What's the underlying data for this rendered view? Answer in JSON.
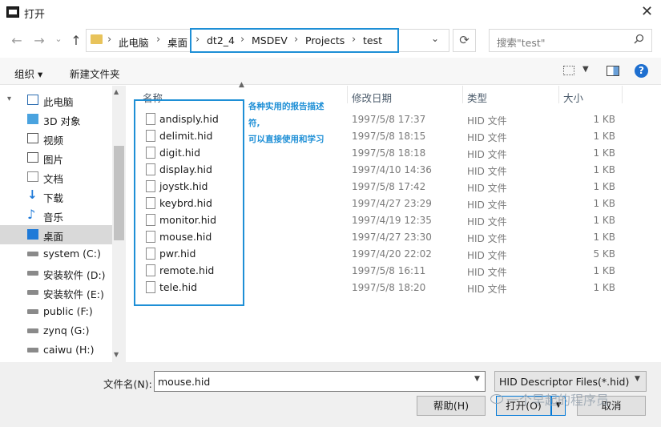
{
  "window": {
    "title": "打开",
    "close_glyph": "✕"
  },
  "nav": {
    "back_glyph": "←",
    "forward_glyph": "→",
    "dropdown_glyph": "⌄",
    "up_glyph": "↑",
    "breadcrumb": [
      "此电脑",
      "桌面",
      "dt2_4",
      "MSDEV",
      "Projects",
      "test"
    ],
    "separator": "›",
    "refresh_glyph": "⟳",
    "search_placeholder": "搜索\"test\"",
    "search_icon": "search-icon"
  },
  "toolbar": {
    "organize": "组织 ▾",
    "new_folder": "新建文件夹",
    "help_glyph": "?"
  },
  "sidebar": {
    "items": [
      {
        "label": "此电脑",
        "icon": "pc-icon"
      },
      {
        "label": "3D 对象",
        "icon": "cube-icon"
      },
      {
        "label": "视频",
        "icon": "video-icon"
      },
      {
        "label": "图片",
        "icon": "picture-icon"
      },
      {
        "label": "文档",
        "icon": "document-icon"
      },
      {
        "label": "下载",
        "icon": "download-icon"
      },
      {
        "label": "音乐",
        "icon": "music-icon"
      },
      {
        "label": "桌面",
        "icon": "desktop-icon",
        "selected": true
      },
      {
        "label": "system (C:)",
        "icon": "drive-icon"
      },
      {
        "label": "安装软件 (D:)",
        "icon": "drive-icon"
      },
      {
        "label": "安装软件 (E:)",
        "icon": "drive-icon"
      },
      {
        "label": "public (F:)",
        "icon": "drive-icon"
      },
      {
        "label": "zynq (G:)",
        "icon": "drive-icon"
      },
      {
        "label": "caiwu (H:)",
        "icon": "drive-icon"
      }
    ]
  },
  "columns": {
    "name": "名称",
    "modified": "修改日期",
    "type": "类型",
    "size": "大小"
  },
  "files": [
    {
      "name": "andisply.hid",
      "modified": "1997/5/8 17:37",
      "type": "HID 文件",
      "size": "1 KB"
    },
    {
      "name": "delimit.hid",
      "modified": "1997/5/8 18:15",
      "type": "HID 文件",
      "size": "1 KB"
    },
    {
      "name": "digit.hid",
      "modified": "1997/5/8 18:18",
      "type": "HID 文件",
      "size": "1 KB"
    },
    {
      "name": "display.hid",
      "modified": "1997/4/10 14:36",
      "type": "HID 文件",
      "size": "1 KB"
    },
    {
      "name": "joystk.hid",
      "modified": "1997/5/8 17:42",
      "type": "HID 文件",
      "size": "1 KB"
    },
    {
      "name": "keybrd.hid",
      "modified": "1997/4/27 23:29",
      "type": "HID 文件",
      "size": "1 KB"
    },
    {
      "name": "monitor.hid",
      "modified": "1997/4/19 12:35",
      "type": "HID 文件",
      "size": "1 KB"
    },
    {
      "name": "mouse.hid",
      "modified": "1997/4/27 23:30",
      "type": "HID 文件",
      "size": "1 KB"
    },
    {
      "name": "pwr.hid",
      "modified": "1997/4/20 22:02",
      "type": "HID 文件",
      "size": "5 KB"
    },
    {
      "name": "remote.hid",
      "modified": "1997/5/8 16:11",
      "type": "HID 文件",
      "size": "1 KB"
    },
    {
      "name": "tele.hid",
      "modified": "1997/5/8 18:20",
      "type": "HID 文件",
      "size": "1 KB"
    }
  ],
  "annotation": [
    "各种实用的报告描述",
    "符,",
    "可以直接使用和学习"
  ],
  "footer": {
    "filename_label": "文件名(N):",
    "filename_value": "mouse.hid",
    "filter": "HID Descriptor Files(*.hid)",
    "help_button": "帮助(H)",
    "open_button": "打开(O)",
    "cancel_button": "取消"
  },
  "watermark": "一个早起的程序员",
  "colors": {
    "accent": "#1e8fd6",
    "selected_bg": "#d9d9d9"
  }
}
